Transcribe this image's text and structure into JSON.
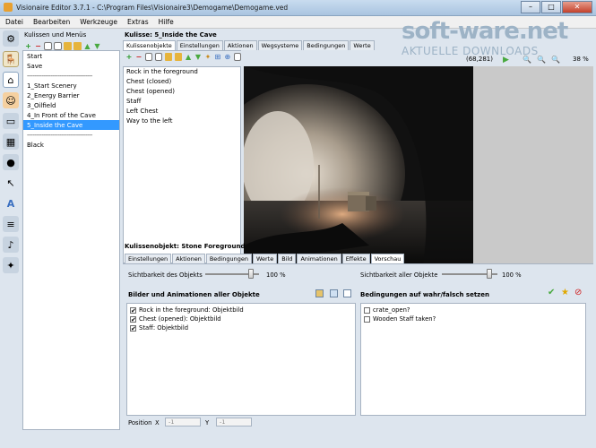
{
  "window": {
    "title": "Visionaire Editor 3.7.1 - C:\\Program Files\\Visionaire3\\Demogame\\Demogame.ved"
  },
  "menu": [
    "Datei",
    "Bearbeiten",
    "Werkzeuge",
    "Extras",
    "Hilfe"
  ],
  "watermark": {
    "line1": "soft-ware.net",
    "line2": "AKTUELLE DOWNLOADS"
  },
  "left_panel": {
    "title": "Kulissen und Menüs",
    "items": [
      {
        "label": "Start",
        "selected": false
      },
      {
        "label": "Save",
        "selected": false
      },
      {
        "label": "------------------------------------",
        "sep": true
      },
      {
        "label": "1_Start Scenery",
        "selected": false
      },
      {
        "label": "2_Energy Barrier",
        "selected": false
      },
      {
        "label": "3_Oilfield",
        "selected": false
      },
      {
        "label": "4_In Front of the Cave",
        "selected": false
      },
      {
        "label": "5_Inside the Cave",
        "selected": true
      },
      {
        "label": "------------------------------------",
        "sep": true
      },
      {
        "label": "Black",
        "selected": false
      }
    ]
  },
  "scene": {
    "header": "Kulisse: 5_Inside the Cave",
    "tabs": [
      "Kulissenobjekte",
      "Einstellungen",
      "Aktionen",
      "Wegsysteme",
      "Bedingungen",
      "Werte"
    ],
    "active_tab": 0,
    "objects": [
      "Rock in the foreground",
      "Chest (closed)",
      "Chest (opened)",
      "Staff",
      "Left Chest",
      "Way to the left"
    ],
    "coords": "(68,281)",
    "zoom": "38 %"
  },
  "object": {
    "header": "Kulissenobjekt: Stone Foreground",
    "tabs": [
      "Einstellungen",
      "Aktionen",
      "Bedingungen",
      "Werte",
      "Bild",
      "Animationen",
      "Effekte",
      "Vorschau"
    ],
    "active_tab": 7,
    "visibility_label": "Sichtbarkeit des Objekts",
    "visibility_value": "100 %",
    "visibility_all_label": "Sichtbarkeit aller Objekte",
    "visibility_all_value": "100 %",
    "images_title": "Bilder und Animationen aller Objekte",
    "images": [
      {
        "label": "Rock in the foreground: Objektbild",
        "checked": true
      },
      {
        "label": "Chest (opened): Objektbild",
        "checked": true
      },
      {
        "label": "Staff: Objektbild",
        "checked": true
      }
    ],
    "conditions_title": "Bedingungen auf wahr/falsch setzen",
    "conditions": [
      {
        "label": "crate_open?",
        "checked": false
      },
      {
        "label": "Wooden Staff taken?",
        "checked": false
      }
    ],
    "position_label": "Position",
    "x_label": "X",
    "y_label": "Y",
    "x_value": "-1",
    "y_value": "-1"
  },
  "colors": {
    "selection": "#3399ff",
    "accent": "#49a93f"
  }
}
